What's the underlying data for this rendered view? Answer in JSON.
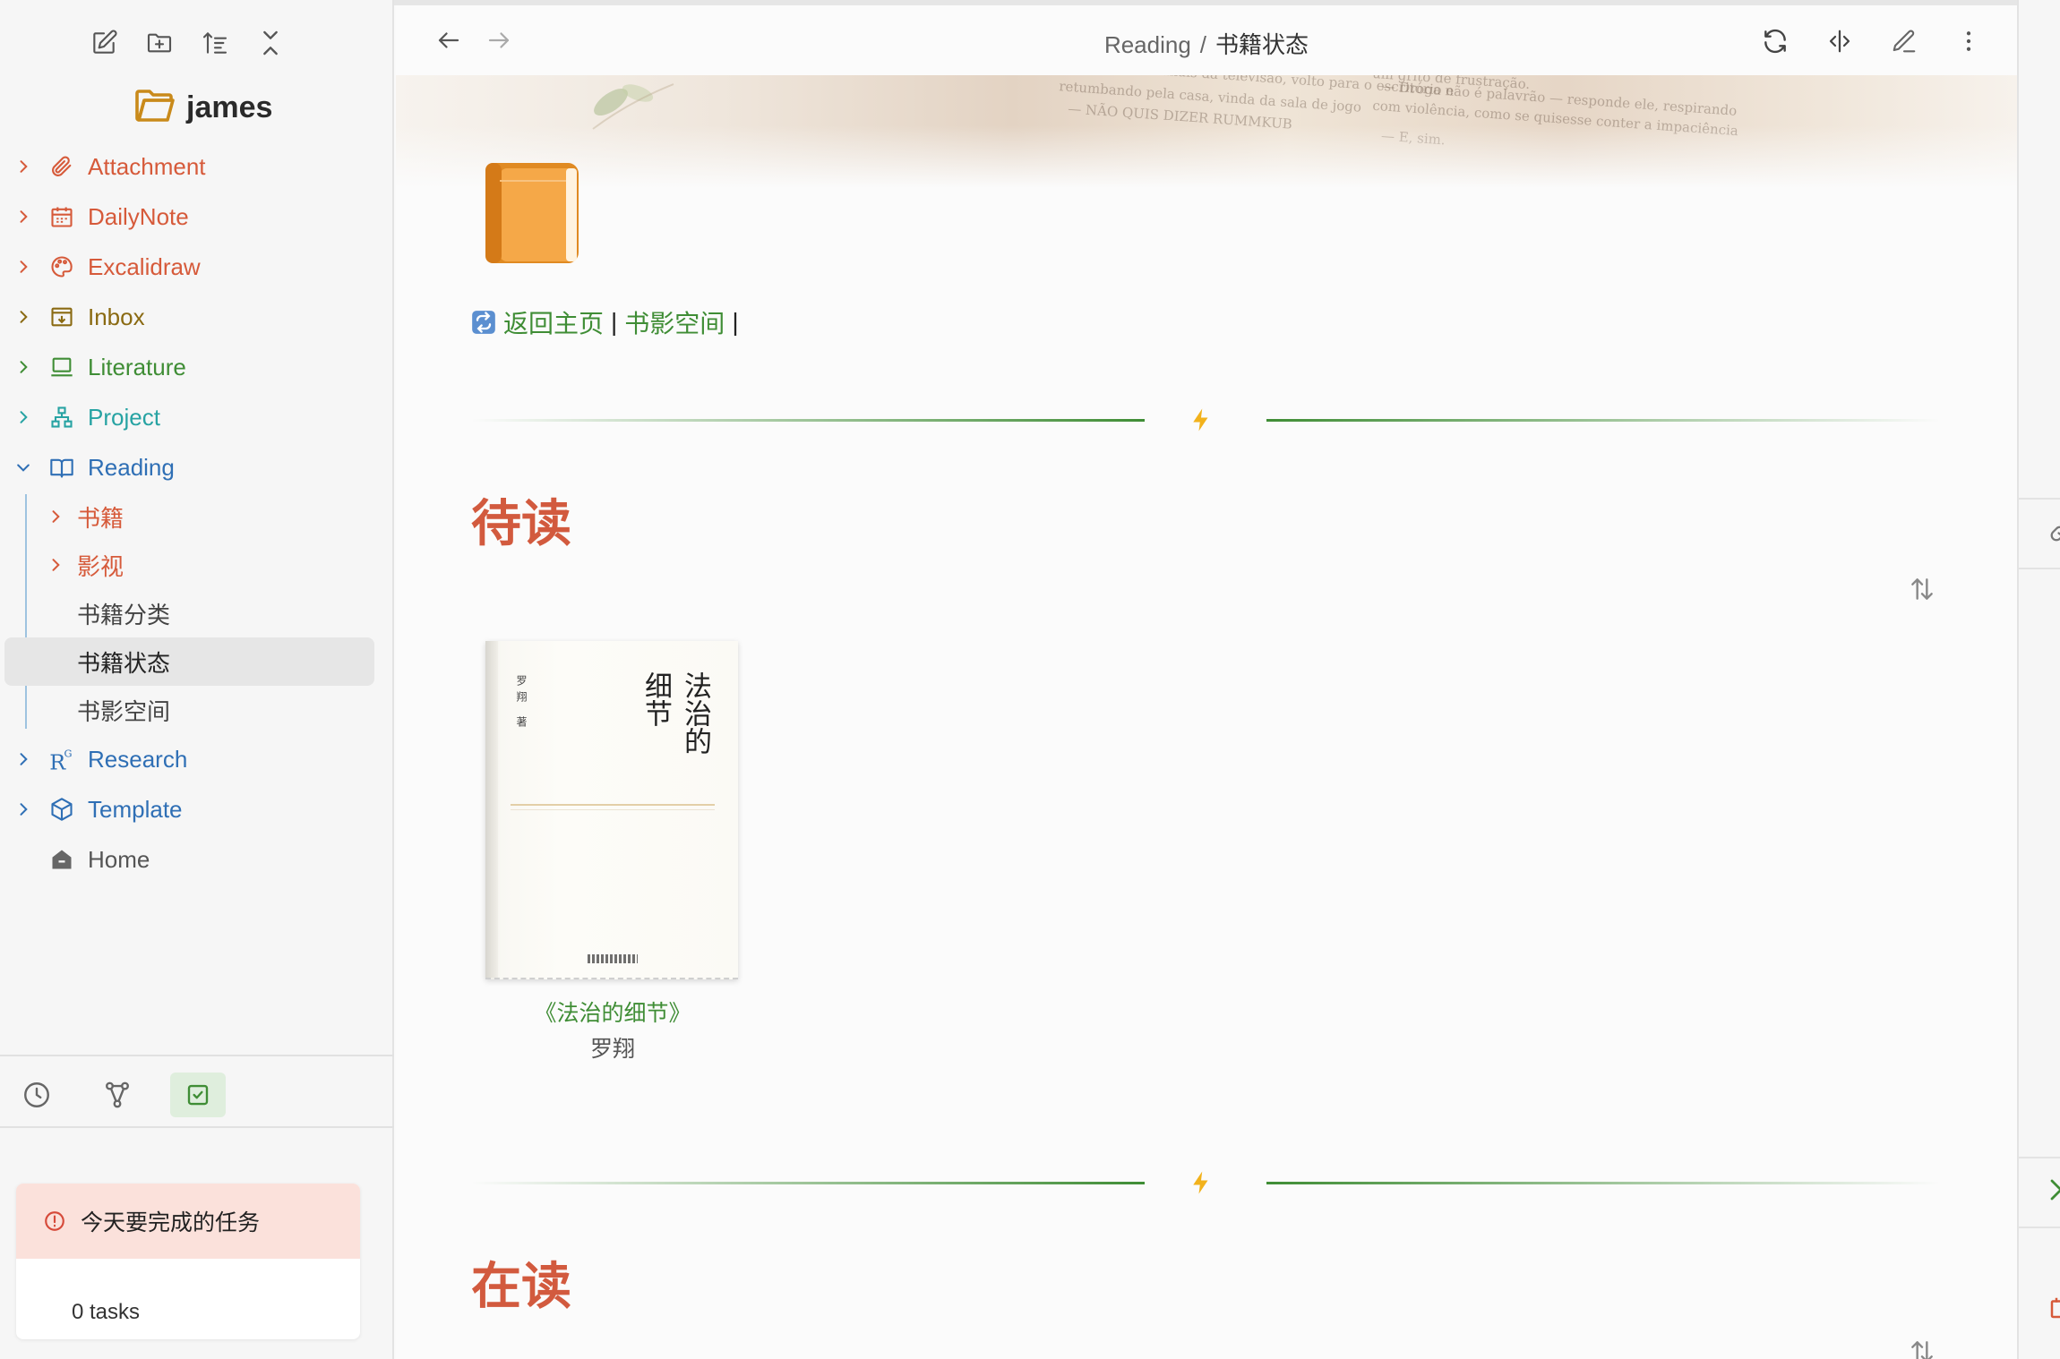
{
  "sidebar": {
    "vault_name": "james",
    "toolbar": [
      "new-note-icon",
      "new-folder-icon",
      "sort-icon",
      "collapse-all-icon"
    ],
    "items": [
      {
        "label": "Attachment",
        "color": "#d65a3a",
        "icon": "paperclip-icon",
        "expanded": false
      },
      {
        "label": "DailyNote",
        "color": "#d65a3a",
        "icon": "calendar-icon",
        "expanded": false
      },
      {
        "label": "Excalidraw",
        "color": "#d65a3a",
        "icon": "palette-icon",
        "expanded": false
      },
      {
        "label": "Inbox",
        "color": "#8a6a12",
        "icon": "inbox-icon",
        "expanded": false
      },
      {
        "label": "Literature",
        "color": "#3f8d35",
        "icon": "laptop-icon",
        "expanded": false
      },
      {
        "label": "Project",
        "color": "#27a3a3",
        "icon": "network-icon",
        "expanded": false
      },
      {
        "label": "Reading",
        "color": "#2f6fb5",
        "icon": "book-open-icon",
        "expanded": true
      },
      {
        "label": "Research",
        "color": "#2f6fb5",
        "icon": "research-icon",
        "expanded": false
      },
      {
        "label": "Template",
        "color": "#2f6fb5",
        "icon": "cube-icon",
        "expanded": false
      },
      {
        "label": "Home",
        "color": "#555555",
        "icon": "home-icon",
        "expanded": false
      }
    ],
    "reading_children": [
      {
        "label": "书籍",
        "folder": true,
        "color": "#d65a3a"
      },
      {
        "label": "影视",
        "folder": true,
        "color": "#d65a3a"
      },
      {
        "label": "书籍分类",
        "folder": false,
        "color": "#444444"
      },
      {
        "label": "书籍状态",
        "folder": false,
        "color": "#222222",
        "active": true
      },
      {
        "label": "书影空间",
        "folder": false,
        "color": "#444444"
      }
    ],
    "bottom_tabs": [
      "clock-icon",
      "graph-icon",
      "task-check-icon"
    ],
    "task_panel": {
      "title": "今天要完成的任务",
      "count": "0 tasks"
    }
  },
  "main": {
    "breadcrumb": {
      "parent": "Reading",
      "separator": "/",
      "current": "书籍状态"
    },
    "home_links": {
      "link1": "返回主页",
      "sep1": "|",
      "link2": "书影空间",
      "sep2": "|"
    },
    "section_pending": {
      "heading": "待读"
    },
    "section_reading": {
      "heading": "在读"
    },
    "books": [
      {
        "title": "《法治的细节》",
        "author": "罗翔",
        "cover_title_col1": "法治的",
        "cover_title_col2": "细节",
        "cover_author": "罗翔 著"
      }
    ],
    "banner_text": [
      "passeio pelos canais da televisão, volto para o escritório e",
      "retumbando pela casa, vinda da sala de jogo",
      "— NÃO QUIS DIZER RUMMKUB",
      "um grito de frustração.",
      "— Droga não é palavrão — responde ele, respirando",
      "com violência, como se quisesse conter a impaciência",
      "— E, sim."
    ],
    "accent_green": "#3f8d35",
    "heading_color": "#d25a3e"
  }
}
